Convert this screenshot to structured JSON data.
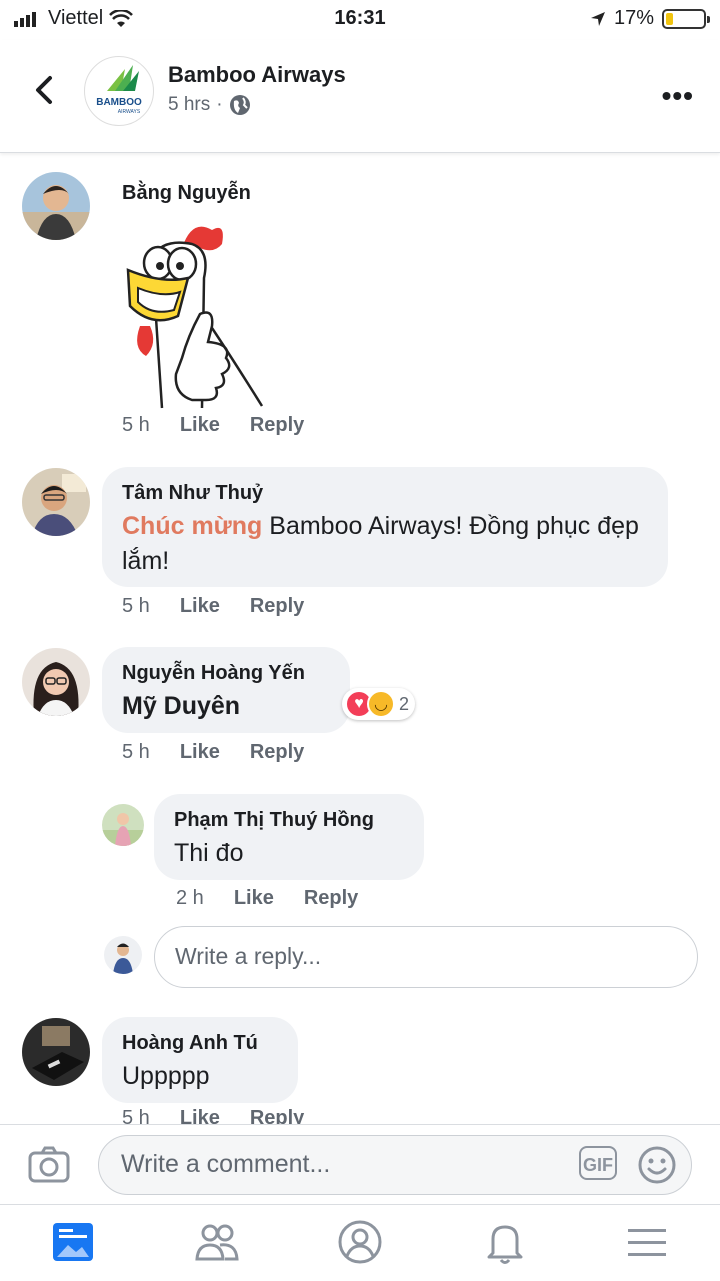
{
  "status_bar": {
    "carrier": "Viettel",
    "time": "16:31",
    "battery": "17%"
  },
  "header": {
    "page_name": "Bamboo Airways",
    "time_ago": "5 hrs",
    "logo_text": "BAMBOO",
    "logo_subtext": "AIRWAYS"
  },
  "comments": [
    {
      "name": "Bằng Nguyễn",
      "text": "",
      "time": "5 h",
      "like": "Like",
      "reply": "Reply"
    },
    {
      "name": "Tâm Như Thuỷ",
      "highlight": "Chúc mừng",
      "text": " Bamboo Airways! Đồng phục đẹp lắm!",
      "time": "5 h",
      "like": "Like",
      "reply": "Reply"
    },
    {
      "name": "Nguyễn Hoàng Yến",
      "text": "Mỹ Duyên",
      "time": "5 h",
      "like": "Like",
      "reply": "Reply",
      "reaction_count": "2"
    },
    {
      "name": "Phạm Thị Thuý Hồng",
      "text": "Thi đo",
      "time": "2 h",
      "like": "Like",
      "reply": "Reply"
    },
    {
      "name": "Hoàng Anh Tú",
      "text": "Uppppp",
      "time": "5 h",
      "like": "Like",
      "reply": "Reply"
    }
  ],
  "reply_input": {
    "placeholder": "Write a reply..."
  },
  "compose": {
    "placeholder": "Write a comment...",
    "gif_label": "GIF"
  },
  "colors": {
    "accent": "#1877f2",
    "highlight": "#e07a5f",
    "bubble": "#f0f2f5"
  },
  "tabs": [
    "news-feed-icon",
    "friends-icon",
    "profile-icon",
    "notifications-icon",
    "menu-icon"
  ]
}
